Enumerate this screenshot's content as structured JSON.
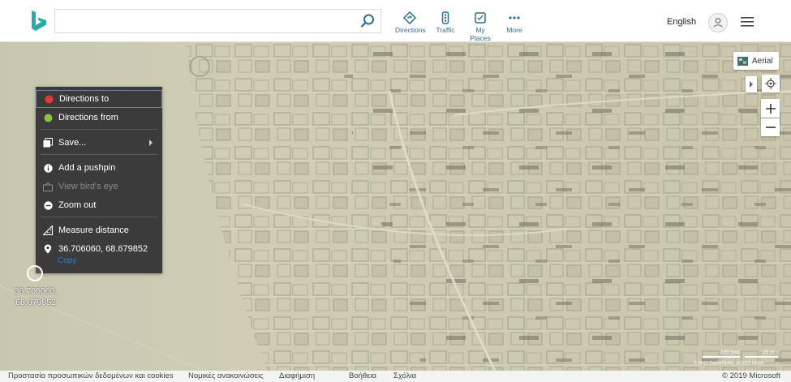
{
  "header": {
    "logo": "bing-logo-icon",
    "search": {
      "value": "",
      "placeholder": ""
    },
    "nav": [
      {
        "label": "Directions",
        "icon": "directions-icon"
      },
      {
        "label": "Traffic",
        "icon": "traffic-icon"
      },
      {
        "label": "My Places",
        "icon": "my-places-icon"
      },
      {
        "label": "More",
        "icon": "more-icon"
      }
    ],
    "language": "English",
    "accent_color": "#2f6f8f"
  },
  "context_menu": {
    "items": [
      {
        "label": "Directions to",
        "icon": "red-dot-icon",
        "color": "#e53935",
        "state": "selected"
      },
      {
        "label": "Directions from",
        "icon": "green-dot-icon",
        "color": "#8bc34a",
        "state": "normal"
      },
      {
        "label": "Save...",
        "icon": "save-icon",
        "state": "submenu"
      },
      {
        "label": "Add a pushpin",
        "icon": "info-icon",
        "state": "normal"
      },
      {
        "label": "View bird's eye",
        "icon": "birds-eye-icon",
        "state": "disabled"
      },
      {
        "label": "Zoom out",
        "icon": "zoom-out-icon",
        "state": "normal"
      },
      {
        "label": "Measure distance",
        "icon": "ruler-icon",
        "state": "normal"
      },
      {
        "label": "36.706060, 68.679852",
        "icon": "location-pin-icon",
        "state": "normal"
      }
    ],
    "copy_label": "Copy"
  },
  "map": {
    "coord_label_line1": "36.706060,",
    "coord_label_line2": "68.679852",
    "style_button": "Aerial",
    "scale_ft": "100 feet",
    "scale_m": "25 m",
    "imagery_credit": "© 2019 DigitalGlobe, © 2019 HERE"
  },
  "footer": {
    "links": [
      "Προστασία προσωπικών δεδομένων και cookies",
      "Νομικές ανακοινώσεις",
      "Διαφήμιση",
      "Βοήθεια",
      "Σχόλια"
    ],
    "copyright": "© 2019 Microsoft"
  }
}
